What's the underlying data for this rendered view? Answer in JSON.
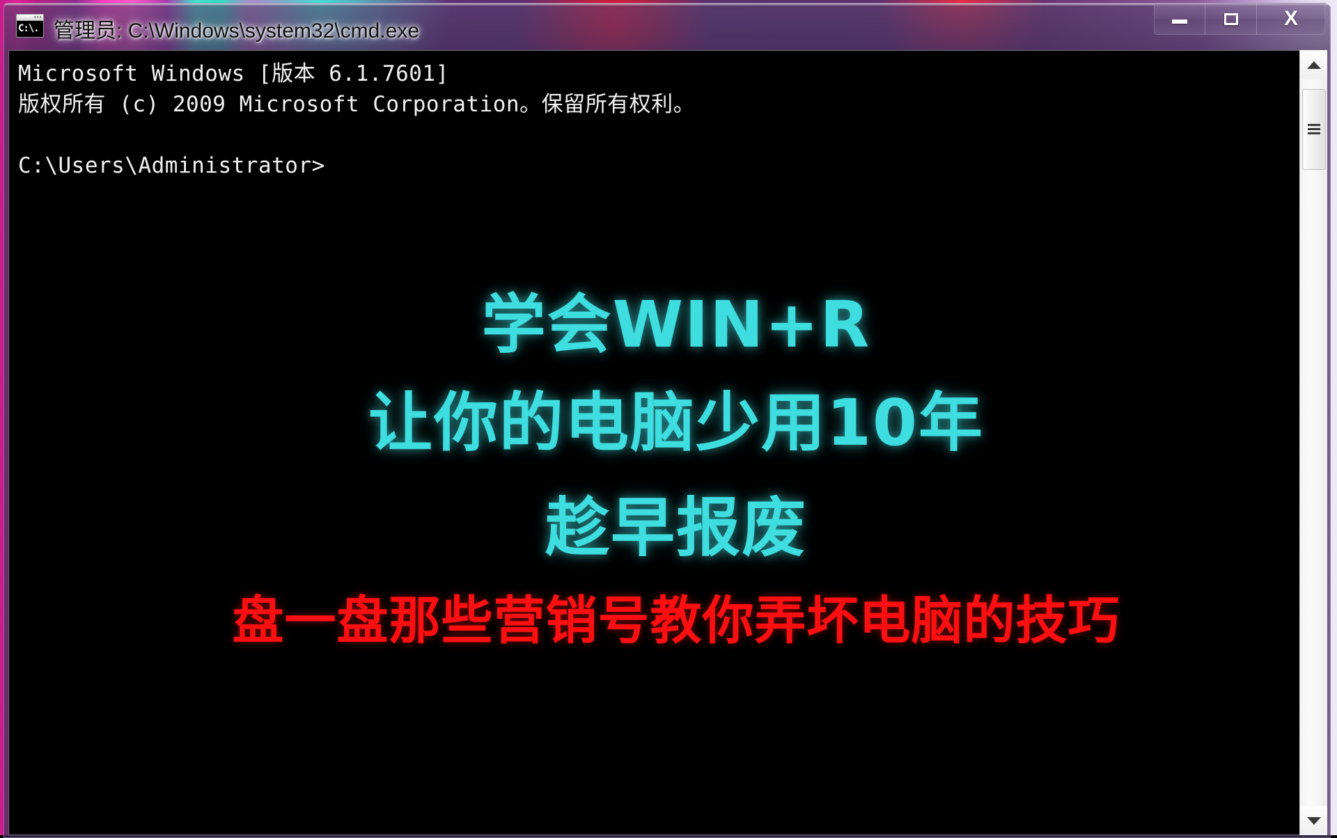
{
  "window": {
    "title": "管理员: C:\\Windows\\system32\\cmd.exe",
    "icon_name": "cmd-icon",
    "icon_glyph": "C:\\.",
    "controls": {
      "minimize_label": "—",
      "maximize_label": "□",
      "close_label": "X"
    }
  },
  "console": {
    "lines": [
      "Microsoft Windows [版本 6.1.7601]",
      "版权所有 (c) 2009 Microsoft Corporation。保留所有权利。",
      "",
      "C:\\Users\\Administrator>"
    ],
    "text_block": "Microsoft Windows [版本 6.1.7601]\n版权所有 (c) 2009 Microsoft Corporation。保留所有权利。\n\nC:\\Users\\Administrator>",
    "background_color": "#000000",
    "foreground_color": "#f2f2f2"
  },
  "scrollbar": {
    "up_arrow": "▲",
    "down_arrow": "▼",
    "thumb_grip": "grip-lines"
  },
  "overlay": {
    "line1": "学会WIN+R",
    "line2": "让你的电脑少用10年",
    "line3": "趁早报废",
    "line4": "盘一盘那些营销号教你弄坏电脑的技巧",
    "cyan_color": "#3edde0",
    "red_color": "#fb0f11"
  }
}
